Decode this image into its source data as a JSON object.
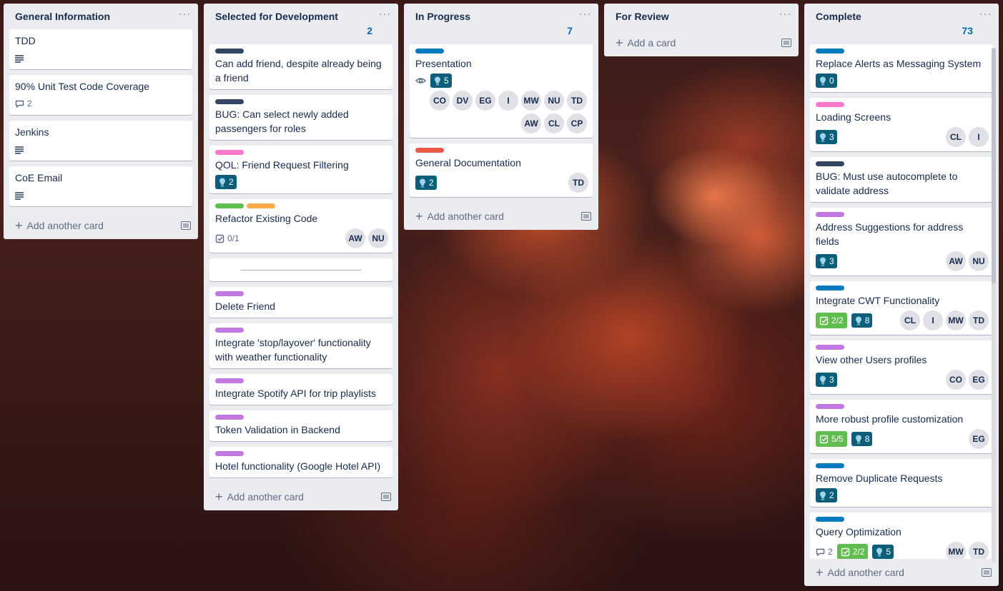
{
  "colors": {
    "navy": "#344563",
    "blue": "#0079bf",
    "pink": "#ff78cb",
    "green": "#61bd4f",
    "orange": "#ffab4a",
    "purple": "#c377e0",
    "red": "#eb5a46",
    "teal_badge": "#0b5f7a",
    "count": "#026aa7"
  },
  "lists": [
    {
      "title": "General Information",
      "menu": "···",
      "count": "",
      "footer": "Add another card",
      "cards": [
        {
          "title": "TDD",
          "description_icon": "description-icon"
        },
        {
          "title": "90% Unit Test Code Coverage",
          "comments": "2"
        },
        {
          "title": "Jenkins",
          "description_icon": "description-icon"
        },
        {
          "title": "CoE Email",
          "description_icon": "description-icon"
        }
      ]
    },
    {
      "title": "Selected for Development",
      "menu": "···",
      "count": "2",
      "footer": "Add another card",
      "cards": [
        {
          "title": "Can add friend, despite already being a friend",
          "labels": [
            "navy"
          ]
        },
        {
          "title": "BUG: Can select newly added passengers for roles",
          "labels": [
            "navy"
          ]
        },
        {
          "title": "QOL: Friend Request Filtering",
          "labels": [
            "pink"
          ],
          "points": "2"
        },
        {
          "title": "Refactor Existing Code",
          "labels": [
            "green",
            "orange"
          ],
          "checklist": "0/1",
          "members": [
            "AW",
            "NU"
          ]
        },
        {
          "title": "",
          "separator": true
        },
        {
          "title": "Delete Friend",
          "labels": [
            "purple"
          ]
        },
        {
          "title": "Integrate 'stop/layover' functionality with weather functionality",
          "labels": [
            "purple"
          ]
        },
        {
          "title": "Integrate Spotify API for trip playlists",
          "labels": [
            "purple"
          ]
        },
        {
          "title": "Token Validation in Backend",
          "labels": [
            "purple"
          ]
        },
        {
          "title": "Hotel functionality (Google Hotel API)",
          "labels": [
            "purple"
          ]
        }
      ]
    },
    {
      "title": "In Progress",
      "menu": "···",
      "count": "7",
      "footer": "Add another card",
      "cards": [
        {
          "title": "Presentation",
          "labels": [
            "blue"
          ],
          "watch": true,
          "points": "5",
          "members": [
            "CO",
            "DV",
            "EG",
            "I",
            "MW",
            "NU",
            "TD",
            "AW",
            "CL",
            "CP"
          ]
        },
        {
          "title": "General Documentation",
          "labels": [
            "red"
          ],
          "points": "2",
          "members": [
            "TD"
          ]
        }
      ]
    },
    {
      "title": "For Review",
      "menu": "···",
      "count": "",
      "footer": "Add a card",
      "cards": []
    },
    {
      "title": "Complete",
      "menu": "···",
      "count": "73",
      "footer": "Add another card",
      "cards": [
        {
          "title": "Replace Alerts as Messaging System",
          "labels": [
            "blue"
          ],
          "points": "0"
        },
        {
          "title": "Loading Screens",
          "labels": [
            "pink"
          ],
          "points": "3",
          "members": [
            "CL",
            "I"
          ]
        },
        {
          "title": "BUG: Must use autocomplete to validate address",
          "labels": [
            "navy"
          ]
        },
        {
          "title": "Address Suggestions for address fields",
          "labels": [
            "purple"
          ],
          "points": "3",
          "members": [
            "AW",
            "NU"
          ]
        },
        {
          "title": "Integrate CWT Functionality",
          "labels": [
            "blue"
          ],
          "checklist_done": "2/2",
          "points": "8",
          "members": [
            "CL",
            "I",
            "MW",
            "TD"
          ]
        },
        {
          "title": "View other Users profiles",
          "labels": [
            "purple"
          ],
          "points": "3",
          "members": [
            "CO",
            "EG"
          ]
        },
        {
          "title": "More robust profile customization",
          "labels": [
            "purple"
          ],
          "checklist_done": "5/5",
          "points": "8",
          "members": [
            "EG"
          ]
        },
        {
          "title": "Remove Duplicate Requests",
          "labels": [
            "blue"
          ],
          "points": "2"
        },
        {
          "title": "Query Optimization",
          "labels": [
            "blue"
          ],
          "comments": "2",
          "checklist_done": "2/2",
          "points": "5",
          "members": [
            "MW",
            "TD"
          ]
        }
      ]
    }
  ]
}
